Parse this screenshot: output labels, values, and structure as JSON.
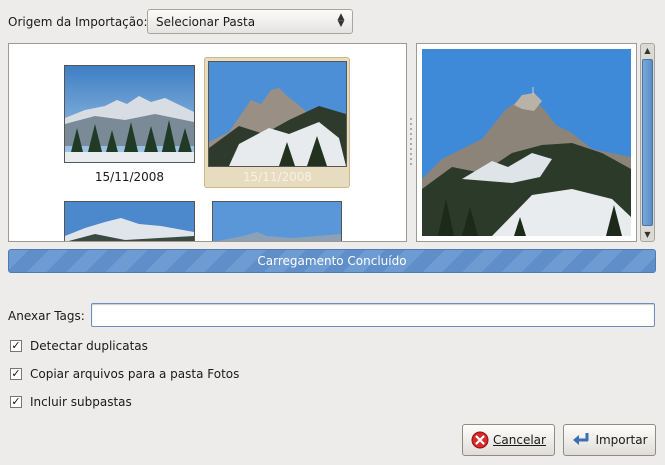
{
  "import_source": {
    "label": "Origem da Importação:",
    "selected": "Selecionar Pasta"
  },
  "thumbnails": [
    {
      "date": "15/11/2008",
      "selected": false
    },
    {
      "date": "15/11/2008",
      "selected": true
    }
  ],
  "progress": {
    "text": "Carregamento Concluído",
    "value": 1.0
  },
  "tags": {
    "label": "Anexar Tags:",
    "value": ""
  },
  "options": [
    {
      "label": "Detectar duplicatas",
      "checked": true
    },
    {
      "label": "Copiar arquivos para a pasta Fotos",
      "checked": true
    },
    {
      "label": "Incluir subpastas",
      "checked": true
    }
  ],
  "buttons": {
    "cancel": "Cancelar",
    "import": "Importar"
  },
  "colors": {
    "selection": "#e7dcc0",
    "progress": "#6e9bd2"
  }
}
